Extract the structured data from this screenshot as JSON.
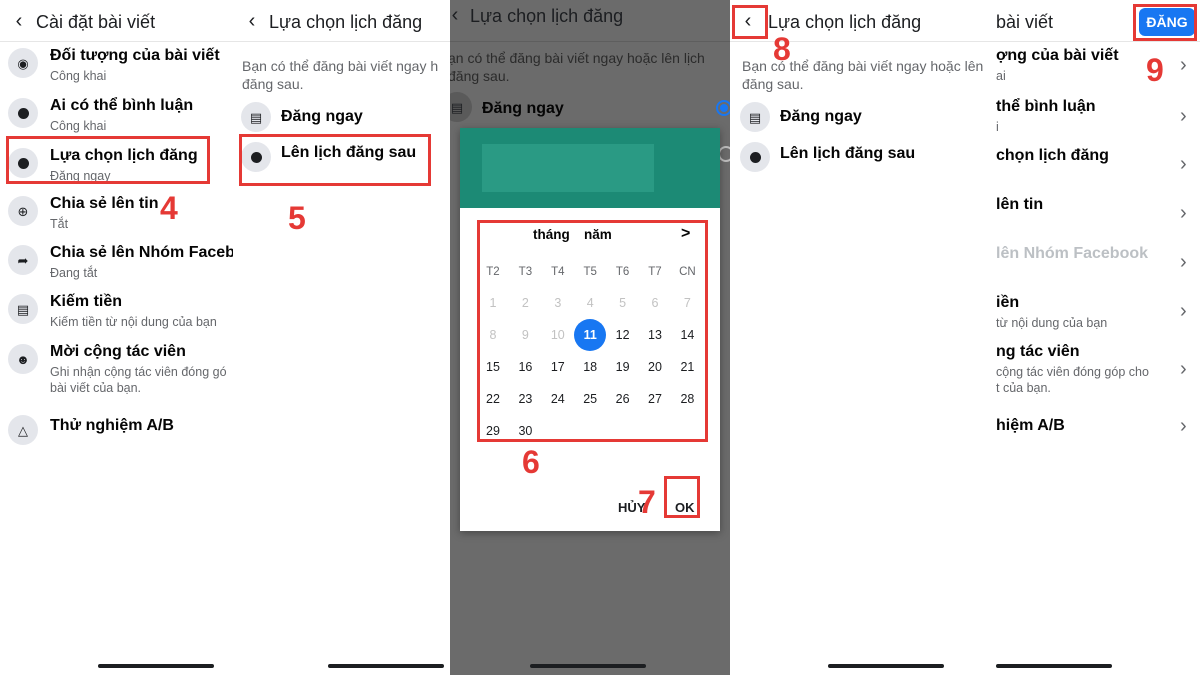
{
  "panel1": {
    "title": "Cài đặt bài viết",
    "items": [
      {
        "title": "Đối tượng của bài viết",
        "sub": "Công khai",
        "icon": "globe-icon"
      },
      {
        "title": "Ai có thể bình luận",
        "sub": "Công khai",
        "icon": "comment-icon"
      },
      {
        "title": "Lựa chọn lịch đăng",
        "sub": "Đăng ngay",
        "icon": "clock-icon"
      },
      {
        "title": "Chia sẻ lên tin",
        "sub": "Tắt",
        "icon": "plus-circle-icon"
      },
      {
        "title": "Chia sẻ lên Nhóm Faceb",
        "sub": "Đang tắt",
        "icon": "share-icon"
      },
      {
        "title": "Kiếm tiền",
        "sub": "Kiếm tiền từ nội dung của bạn",
        "icon": "money-icon"
      },
      {
        "title": "Mời cộng tác viên",
        "sub": "Ghi nhận cộng tác viên đóng gó",
        "sub2": "bài viết của bạn.",
        "icon": "add-person-icon"
      },
      {
        "title": "Thử nghiệm A/B",
        "sub": "",
        "icon": "flask-icon"
      }
    ],
    "step": "4"
  },
  "panel2": {
    "title": "Lựa chọn lịch đăng",
    "desc1": "Bạn có thể đăng bài viết ngay h",
    "desc2": "đăng sau.",
    "options": [
      {
        "label": "Đăng ngay",
        "icon": "post-now-icon"
      },
      {
        "label": "Lên lịch đăng sau",
        "icon": "clock-icon"
      }
    ],
    "step": "5"
  },
  "panel3": {
    "title": "Lựa chọn lịch đăng",
    "desc1": "ạn có thể đăng bài viết ngay hoặc lên lịch",
    "desc2": "đăng sau.",
    "option": "Đăng ngay",
    "calendar": {
      "month_label": "tháng",
      "year_label": "năm",
      "next": ">",
      "weekdays": [
        "T2",
        "T3",
        "T4",
        "T5",
        "T6",
        "T7",
        "CN"
      ],
      "weeks": [
        [
          "1",
          "2",
          "3",
          "4",
          "5",
          "6",
          "7"
        ],
        [
          "8",
          "9",
          "10",
          "11",
          "12",
          "13",
          "14"
        ],
        [
          "15",
          "16",
          "17",
          "18",
          "19",
          "20",
          "21"
        ],
        [
          "22",
          "23",
          "24",
          "25",
          "26",
          "27",
          "28"
        ],
        [
          "29",
          "30",
          "",
          "",
          "",
          "",
          ""
        ]
      ],
      "selected": "11",
      "cancel": "HỦY",
      "ok": "OK"
    },
    "step6": "6",
    "step7": "7"
  },
  "panel4": {
    "title": "Lựa chọn lịch đăng",
    "desc1": "Bạn có thể đăng bài viết ngay hoặc lên",
    "desc2": "đăng sau.",
    "options": [
      {
        "label": "Đăng ngay",
        "icon": "post-now-icon"
      },
      {
        "label": "Lên lịch đăng sau",
        "icon": "clock-icon"
      }
    ],
    "step": "8"
  },
  "panel5": {
    "title": "bài viết",
    "post_button": "ĐĂNG",
    "items": [
      {
        "title": "ợng của bài viết",
        "sub": "ai"
      },
      {
        "title": "thể bình luận",
        "sub": "i"
      },
      {
        "title": "chọn lịch đăng",
        "sub": ""
      },
      {
        "title": "lên tin",
        "sub": ""
      },
      {
        "title": "lên Nhóm Facebook",
        "sub": ""
      },
      {
        "title": "iền",
        "sub": "từ nội dung của bạn"
      },
      {
        "title": "ng tác viên",
        "sub": "cộng tác viên đóng góp cho",
        "sub2": "t của bạn."
      },
      {
        "title": "hiệm A/B",
        "sub": ""
      }
    ],
    "step": "9"
  },
  "colors": {
    "accent": "#1877f2",
    "annotation": "#e53935",
    "dialog_header": "#1c8a75"
  }
}
